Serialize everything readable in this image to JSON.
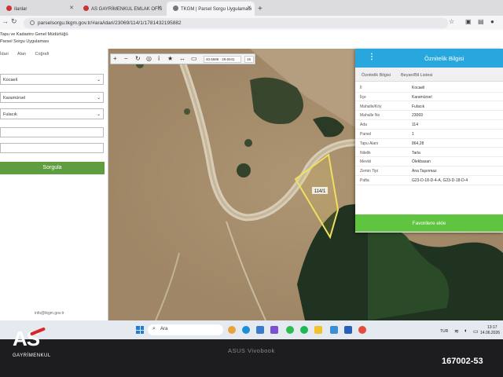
{
  "browser": {
    "tabs": [
      {
        "label": "Ilanlar"
      },
      {
        "label": "AS GAYRİMENKUL EMLAK OFİS"
      },
      {
        "label": "TKGM | Parsel Sorgu Uygulaması"
      }
    ],
    "url": "parselsorgu.tkgm.gov.tr/#ara/idari/23069/114/1/1781432195882"
  },
  "site": {
    "org_line1": "Tapu ve Kadastro Genel Müdürlüğü",
    "org_line2": "Parsel Sorgu Uygulaması"
  },
  "left_panel": {
    "tabs": [
      "İdari",
      "Alan",
      "Coğrafi"
    ],
    "selects": [
      {
        "value": "Kocaeli"
      },
      {
        "value": "Karamürsel"
      },
      {
        "value": "Fulacık"
      }
    ],
    "query_button": "Sorgula",
    "footer_email": "info@tkgm.gov.tr"
  },
  "map": {
    "coordinates": "40.6688 · 29.6041",
    "zoom": "16",
    "parcel_label": "114/1"
  },
  "attr_panel": {
    "title": "Öznitelik Bilgisi",
    "tabs": [
      "Öznitelik Bilgisi",
      "Beyan/Bil Listesi"
    ],
    "rows": [
      {
        "key": "İl",
        "value": "Kocaeli"
      },
      {
        "key": "İlçe",
        "value": "Karamürsel"
      },
      {
        "key": "Mahalle/Köy",
        "value": "Fulacık"
      },
      {
        "key": "Mahalle No",
        "value": "23069"
      },
      {
        "key": "Ada",
        "value": "114"
      },
      {
        "key": "Parsel",
        "value": "1"
      },
      {
        "key": "Tapu Alanı",
        "value": "864,28"
      },
      {
        "key": "Nitelik",
        "value": "Tarla"
      },
      {
        "key": "Mevkii",
        "value": "Ölekbasan"
      },
      {
        "key": "Zemin Tipi",
        "value": "Ana Taşınmaz"
      },
      {
        "key": "Pafta",
        "value": "G23-D-18-D-4-A, G23-D-18-D-4"
      }
    ],
    "favorite_button": "Favorilere ekle"
  },
  "taskbar": {
    "search_placeholder": "Ara",
    "lang": "TUR",
    "time": "13:17",
    "date": "14.06.2026"
  },
  "laptop": {
    "brand": "ASUS Vivobook"
  },
  "watermark": {
    "logo_text": "AS",
    "logo_sub": "GAYRİMENKUL",
    "ref_code": "167002-53"
  },
  "colors": {
    "accent_blue": "#27a7dd",
    "button_green": "#5fc440",
    "query_green": "#5f9e40",
    "parcel_outline": "#f0e060"
  }
}
